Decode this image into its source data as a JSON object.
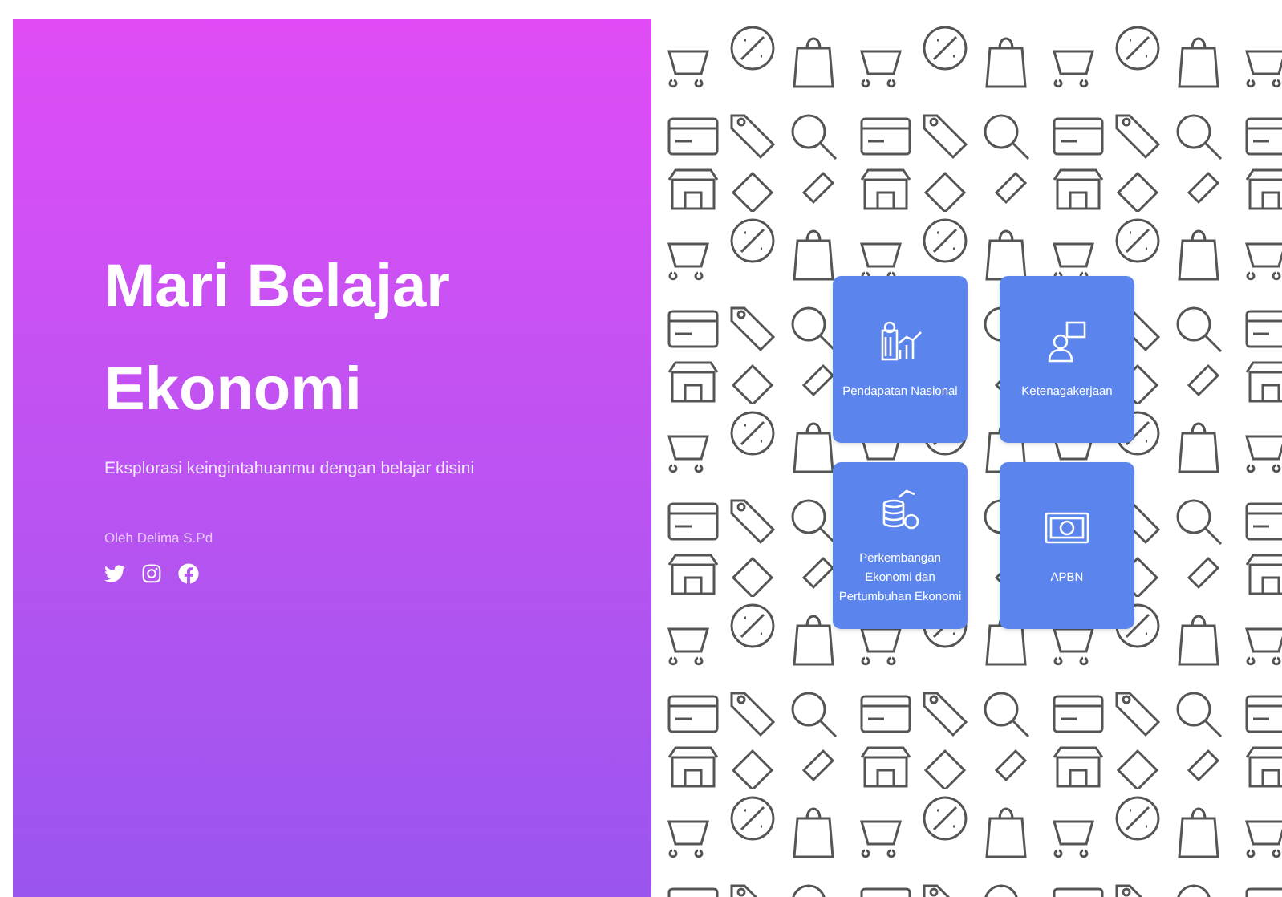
{
  "hero": {
    "title_line_1": "Mari Belajar",
    "title_line_2": "Ekonomi",
    "subtitle": "Eksplorasi keingintahuanmu dengan belajar disini",
    "author": "Oleh Delima S.Pd",
    "social": [
      {
        "kind": "twitter"
      },
      {
        "kind": "instagram"
      },
      {
        "kind": "facebook"
      }
    ]
  },
  "topics": [
    {
      "kind": "income",
      "label": "Pendapatan Nasional"
    },
    {
      "kind": "labor",
      "label": "Ketenagakerjaan"
    },
    {
      "kind": "growth",
      "label": "Perkembangan Ekonomi dan Pertumbuhan Ekonomi"
    },
    {
      "kind": "budget",
      "label": "APBN"
    }
  ]
}
